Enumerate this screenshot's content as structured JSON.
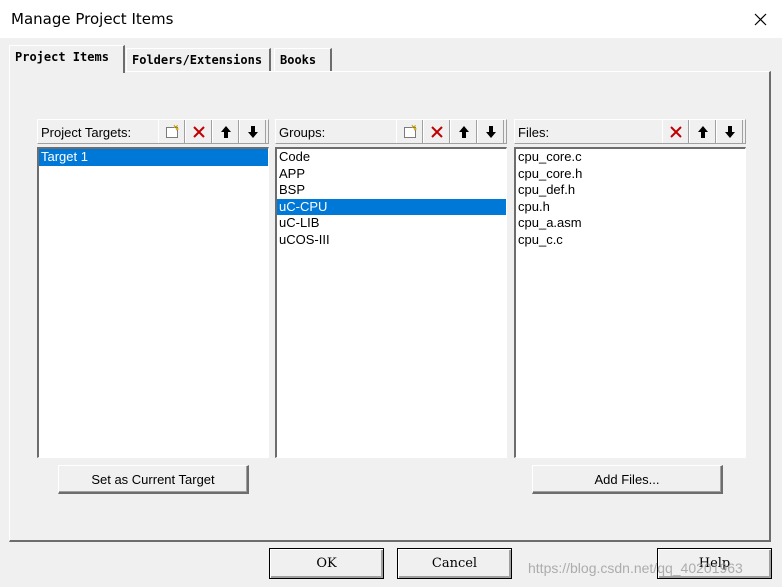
{
  "window": {
    "title": "Manage Project Items"
  },
  "tabs": [
    {
      "label": "Project Items",
      "active": true
    },
    {
      "label": "Folders/Extensions",
      "active": false
    },
    {
      "label": "Books",
      "active": false
    }
  ],
  "targets": {
    "header": "Project Targets:",
    "items": [
      "Target 1"
    ],
    "selected_index": 0,
    "button_label": "Set as Current Target"
  },
  "groups": {
    "header": "Groups:",
    "items": [
      "Code",
      "APP",
      "BSP",
      "uC-CPU",
      "uC-LIB",
      "uCOS-III"
    ],
    "selected_index": 3
  },
  "files": {
    "header": "Files:",
    "items": [
      "cpu_core.c",
      "cpu_core.h",
      "cpu_def.h",
      "cpu.h",
      "cpu_a.asm",
      "cpu_c.c"
    ],
    "button_label": "Add Files..."
  },
  "footer": {
    "ok_label": "OK",
    "cancel_label": "Cancel",
    "help_label": "Help"
  },
  "watermark": "https://blog.csdn.net/qq_40201963",
  "colors": {
    "selection": "#0078d7",
    "delete_icon": "#c00000"
  }
}
